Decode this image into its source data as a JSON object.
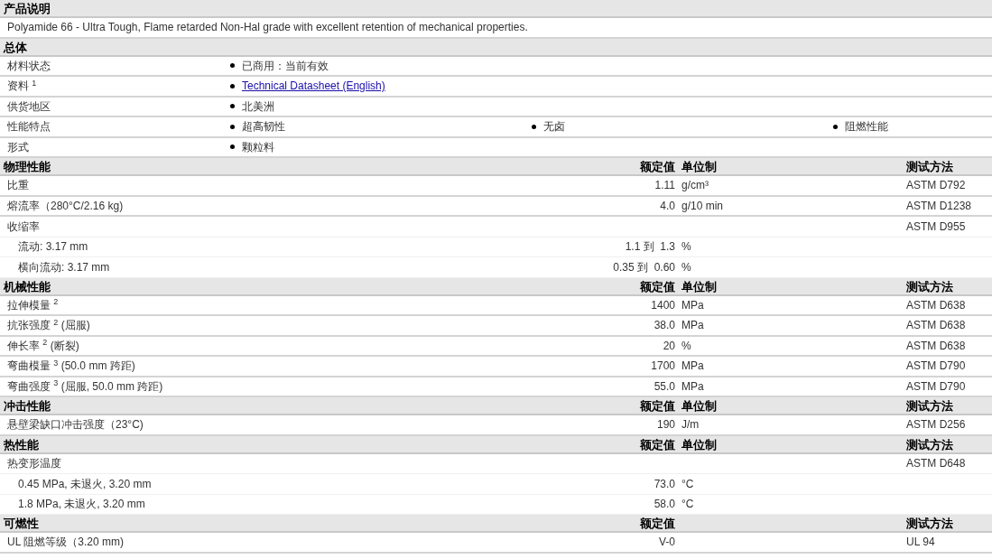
{
  "sections": [
    {
      "kind": "text",
      "title": "产品说明",
      "text": "Polyamide 66 - Ultra Tough, Flame retarded Non-Hal grade with excellent retention of mechanical properties."
    },
    {
      "kind": "general",
      "title": "总体",
      "rows": [
        {
          "label": "材料状态",
          "items": [
            {
              "kind": "text",
              "text": "已商用：当前有效"
            }
          ]
        },
        {
          "label": "资料 $^{1}$",
          "items": [
            {
              "kind": "link",
              "text": "Technical Datasheet (English)"
            }
          ]
        },
        {
          "label": "供货地区",
          "items": [
            {
              "kind": "text",
              "text": "北美洲"
            }
          ]
        },
        {
          "label": "性能特点",
          "items": [
            {
              "kind": "text",
              "text": "超高韧性"
            },
            {
              "kind": "text",
              "text": "无卤"
            },
            {
              "kind": "text",
              "text": "阻燃性能"
            }
          ]
        },
        {
          "label": "形式",
          "items": [
            {
              "kind": "text",
              "text": "颗粒料"
            }
          ]
        }
      ]
    },
    {
      "kind": "properties",
      "title": "物理性能",
      "header": {
        "value": "额定值",
        "unit": "单位制",
        "method": "测试方法"
      },
      "rows": [
        {
          "label": "比重",
          "value": "1.11",
          "unit": "g/cm³",
          "method": "ASTM D792"
        },
        {
          "label": "熔流率（280°C/2.16 kg)",
          "value": "4.0",
          "unit": "g/10 min",
          "method": "ASTM D1238"
        },
        {
          "label": "收缩率",
          "method": "ASTM D955",
          "children": [
            {
              "label": "流动: 3.17 mm",
              "value": "1.1 到  1.3",
              "unit": "%"
            },
            {
              "label": "横向流动: 3.17 mm",
              "value": "0.35 到  0.60",
              "unit": "%"
            }
          ]
        }
      ]
    },
    {
      "kind": "properties",
      "title": "机械性能",
      "header": {
        "value": "额定值",
        "unit": "单位制",
        "method": "测试方法"
      },
      "rows": [
        {
          "label": "拉伸模量 $^{2}$",
          "value": "1400",
          "unit": "MPa",
          "method": "ASTM D638"
        },
        {
          "label": "抗张强度 $^{2}$ (屈服)",
          "value": "38.0",
          "unit": "MPa",
          "method": "ASTM D638"
        },
        {
          "label": "伸长率 $^{2}$ (断裂)",
          "value": "20",
          "unit": "%",
          "method": "ASTM D638"
        },
        {
          "label": "弯曲模量 $^{3}$ (50.0 mm 跨距)",
          "value": "1700",
          "unit": "MPa",
          "method": "ASTM D790"
        },
        {
          "label": "弯曲强度 $^{3}$ (屈服, 50.0 mm 跨距)",
          "value": "55.0",
          "unit": "MPa",
          "method": "ASTM D790"
        }
      ]
    },
    {
      "kind": "properties",
      "title": "冲击性能",
      "header": {
        "value": "额定值",
        "unit": "单位制",
        "method": "测试方法"
      },
      "rows": [
        {
          "label": "悬壁梁缺口冲击强度（23°C)",
          "value": "190",
          "unit": "J/m",
          "method": "ASTM D256"
        }
      ]
    },
    {
      "kind": "properties",
      "title": "热性能",
      "header": {
        "value": "额定值",
        "unit": "单位制",
        "method": "测试方法"
      },
      "rows": [
        {
          "label": "热变形温度",
          "method": "ASTM D648",
          "children": [
            {
              "label": "0.45 MPa, 未退火, 3.20 mm",
              "value": "73.0",
              "unit": "°C"
            },
            {
              "label": "1.8 MPa, 未退火, 3.20 mm",
              "value": "58.0",
              "unit": "°C"
            }
          ]
        }
      ]
    },
    {
      "kind": "properties",
      "title": "可燃性",
      "header": {
        "value": "额定值",
        "method": "测试方法"
      },
      "rows": [
        {
          "label": "UL 阻燃等级（3.20 mm)",
          "value": "V-0",
          "method": "UL 94"
        }
      ]
    }
  ]
}
